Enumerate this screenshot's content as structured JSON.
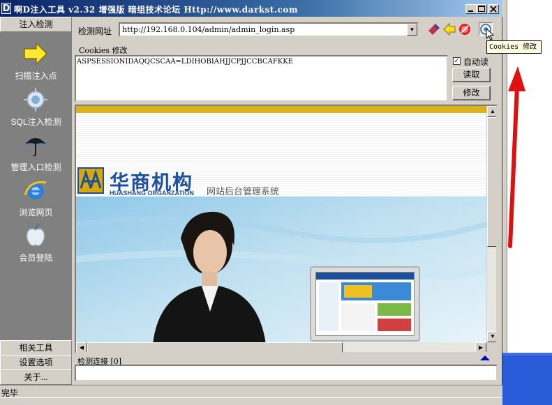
{
  "window": {
    "app_icon": "D",
    "title": "啊D注入工具 v2.32 增强版 暗组技术论坛 Http://www.darkst.com",
    "controls": [
      "minimize-icon",
      "maximize-icon",
      "close-icon"
    ]
  },
  "sidebar": {
    "header": "注入检测",
    "items": [
      {
        "label": "扫描注入点",
        "icon": "arrow-right-icon"
      },
      {
        "label": "SQL注入检测",
        "icon": "target-icon"
      },
      {
        "label": "管理入口检测",
        "icon": "umbrella-icon"
      },
      {
        "label": "浏览网页",
        "icon": "ie-browser-icon"
      },
      {
        "label": "会员登陆",
        "icon": "apple-icon"
      }
    ],
    "bottom": [
      "相关工具",
      "设置选项",
      "关于..."
    ]
  },
  "detect": {
    "url_label": "检测网址",
    "url_value": "http://192.168.0.104/admin/admin_login.asp"
  },
  "toolbar_icons": [
    "edit-icon",
    "back-arrow-icon",
    "stop-icon",
    "cookies-icon"
  ],
  "cookies": {
    "label": "Cookies 修改",
    "value": "ASPSESSIONIDAQQCSCAA=LDIHOBIAHJJCPJJCCBCAFKKE",
    "auto_read_label": "自动读",
    "auto_read_checked": true,
    "read_button": "读取",
    "modify_button": "修改",
    "tooltip": "Cookies 修改"
  },
  "site": {
    "logo_cn": "华商机构",
    "logo_en": "HUASHANG ORGANZATION",
    "subtitle": "网站后台管理系统"
  },
  "connection": {
    "label": "检测连接 [0]"
  },
  "status": {
    "text": "完毕"
  },
  "colors": {
    "titlebar_start": "#0a246a",
    "sidebar_bg": "#808080",
    "annotation_arrow": "#e01010",
    "brand_blue": "#1c4f9c",
    "brand_gold": "#d6a80b"
  }
}
